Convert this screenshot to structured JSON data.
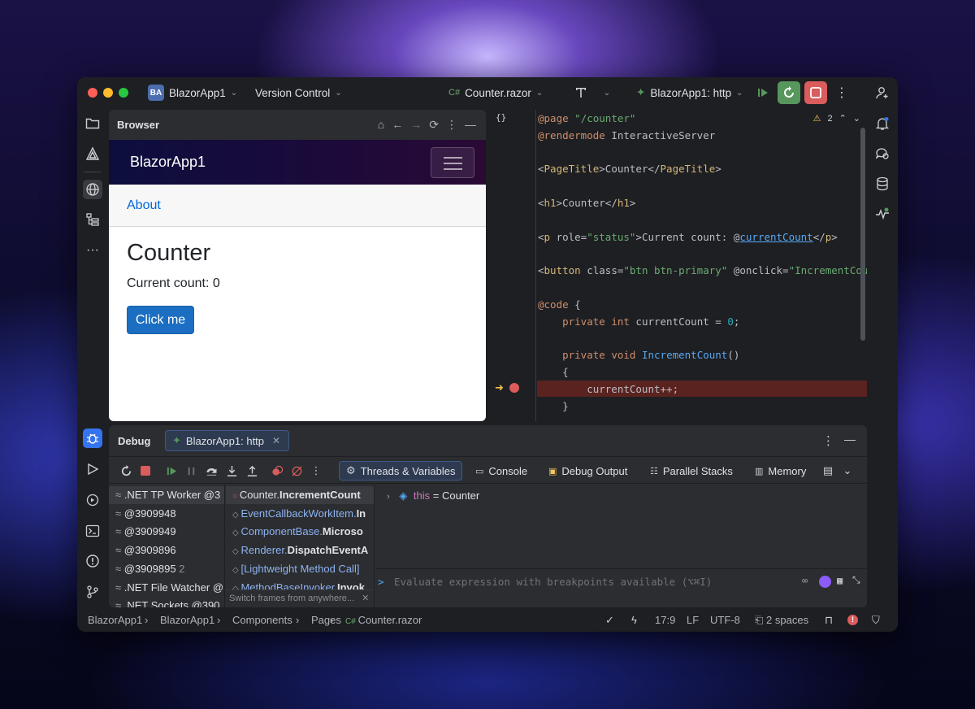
{
  "colors": {
    "accent": "#3574f0",
    "debug_red": "#db5c5c",
    "run_green": "#57965c",
    "exec_line": "#5a2320",
    "blazor_link": "#0366d6",
    "blazor_button": "#1b6ec2"
  },
  "titlebar": {
    "project_badge": "BA",
    "project": "BlazorApp1",
    "vcs": "Version Control",
    "file": "Counter.razor",
    "run_config": "BlazorApp1: http"
  },
  "browser": {
    "title": "Browser",
    "app": {
      "brand": "BlazorApp1",
      "nav_link": "About",
      "heading": "Counter",
      "count_text": "Current count: 0",
      "button": "Click me"
    }
  },
  "editor": {
    "braces_icon": "{}",
    "warnings": "2",
    "lines": [
      "@page \"/counter\"",
      "@rendermode InteractiveServer",
      "",
      "<PageTitle>Counter</PageTitle>",
      "",
      "<h1>Counter</h1>",
      "",
      "<p role=\"status\">Current count: @currentCount</p>",
      "",
      "<button class=\"btn btn-primary\" @onclick=\"IncrementCount\">",
      "",
      "@code {",
      "    private int currentCount = 0;",
      "",
      "    private void IncrementCount()",
      "    {",
      "        currentCount++;",
      "    }"
    ]
  },
  "debug": {
    "title": "Debug",
    "session_tab": "BlazorApp1: http",
    "tabs": [
      "Threads & Variables",
      "Console",
      "Debug Output",
      "Parallel Stacks",
      "Memory"
    ],
    "threads": [
      {
        "name": ".NET TP Worker @3",
        "count": ""
      },
      {
        "name": "@3909948",
        "count": ""
      },
      {
        "name": "@3909949",
        "count": ""
      },
      {
        "name": "@3909896",
        "count": ""
      },
      {
        "name": "@3909895",
        "count": "2"
      },
      {
        "name": ".NET File Watcher @",
        "count": ""
      },
      {
        "name": ".NET Sockets @390",
        "count": ""
      }
    ],
    "frames": [
      {
        "prefix": "Counter.",
        "method": "IncrementCount"
      },
      {
        "prefix": "EventCallbackWorkItem.",
        "method": "In"
      },
      {
        "prefix": "ComponentBase.",
        "method": "Microso"
      },
      {
        "prefix": "Renderer.",
        "method": "DispatchEventA"
      },
      {
        "prefix": "[Lightweight Method Call]",
        "method": ""
      },
      {
        "prefix": "MethodBaseInvoker.",
        "method": "Invok"
      }
    ],
    "frames_hint": "Switch frames from anywhere...",
    "variable": {
      "name": "this",
      "value": "= Counter"
    },
    "eval_prompt": ">",
    "eval_placeholder": "Evaluate expression with breakpoints available (⌥⌘I)"
  },
  "statusbar": {
    "breadcrumbs": [
      "BlazorApp1",
      "BlazorApp1",
      "Components",
      "Pages",
      "Counter.razor"
    ],
    "position": "17:9",
    "line_ending": "LF",
    "encoding": "UTF-8",
    "indent": "2 spaces"
  }
}
